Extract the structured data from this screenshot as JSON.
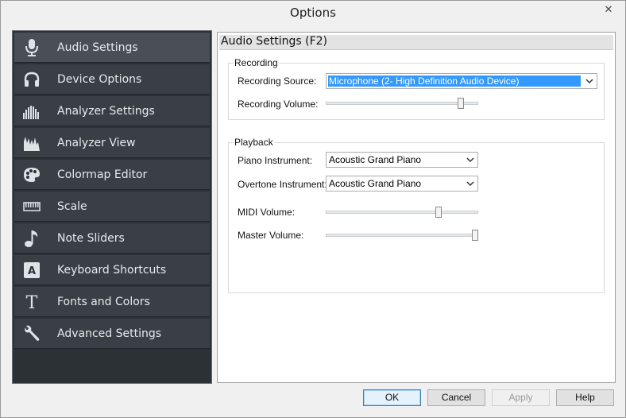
{
  "window": {
    "title": "Options",
    "close_glyph": "✕"
  },
  "sidebar": {
    "items": [
      {
        "label": "Audio Settings",
        "icon": "microphone-icon",
        "active": true
      },
      {
        "label": "Device Options",
        "icon": "headphones-icon"
      },
      {
        "label": "Analyzer Settings",
        "icon": "analyzer-settings-icon"
      },
      {
        "label": "Analyzer View",
        "icon": "analyzer-view-icon"
      },
      {
        "label": "Colormap Editor",
        "icon": "palette-icon"
      },
      {
        "label": "Scale",
        "icon": "piano-keys-icon"
      },
      {
        "label": "Note Sliders",
        "icon": "music-note-icon"
      },
      {
        "label": "Keyboard Shortcuts",
        "icon": "keyboard-letter-a-icon"
      },
      {
        "label": "Fonts and Colors",
        "icon": "font-t-icon"
      },
      {
        "label": "Advanced Settings",
        "icon": "wrench-icon"
      }
    ]
  },
  "content": {
    "header": "Audio Settings (F2)",
    "recording": {
      "legend": "Recording",
      "source_label": "Recording Source:",
      "source_value": "Microphone (2- High Definition Audio Device)",
      "volume_label": "Recording Volume:",
      "volume_level": 0.9
    },
    "playback": {
      "legend": "Playback",
      "piano_label": "Piano Instrument:",
      "piano_value": "Acoustic Grand Piano",
      "overtone_label": "Overtone Instrument:",
      "overtone_value": "Acoustic Grand Piano",
      "midi_label": "MIDI Volume:",
      "midi_level": 0.75,
      "master_label": "Master Volume:",
      "master_level": 1.0
    }
  },
  "buttons": {
    "ok": "OK",
    "cancel": "Cancel",
    "apply": "Apply",
    "help": "Help"
  },
  "colors": {
    "sidebar_bg": "#2c3136",
    "item_bg": "#3a3f45",
    "active_bg": "#4a4f56",
    "selection": "#3399ff"
  }
}
